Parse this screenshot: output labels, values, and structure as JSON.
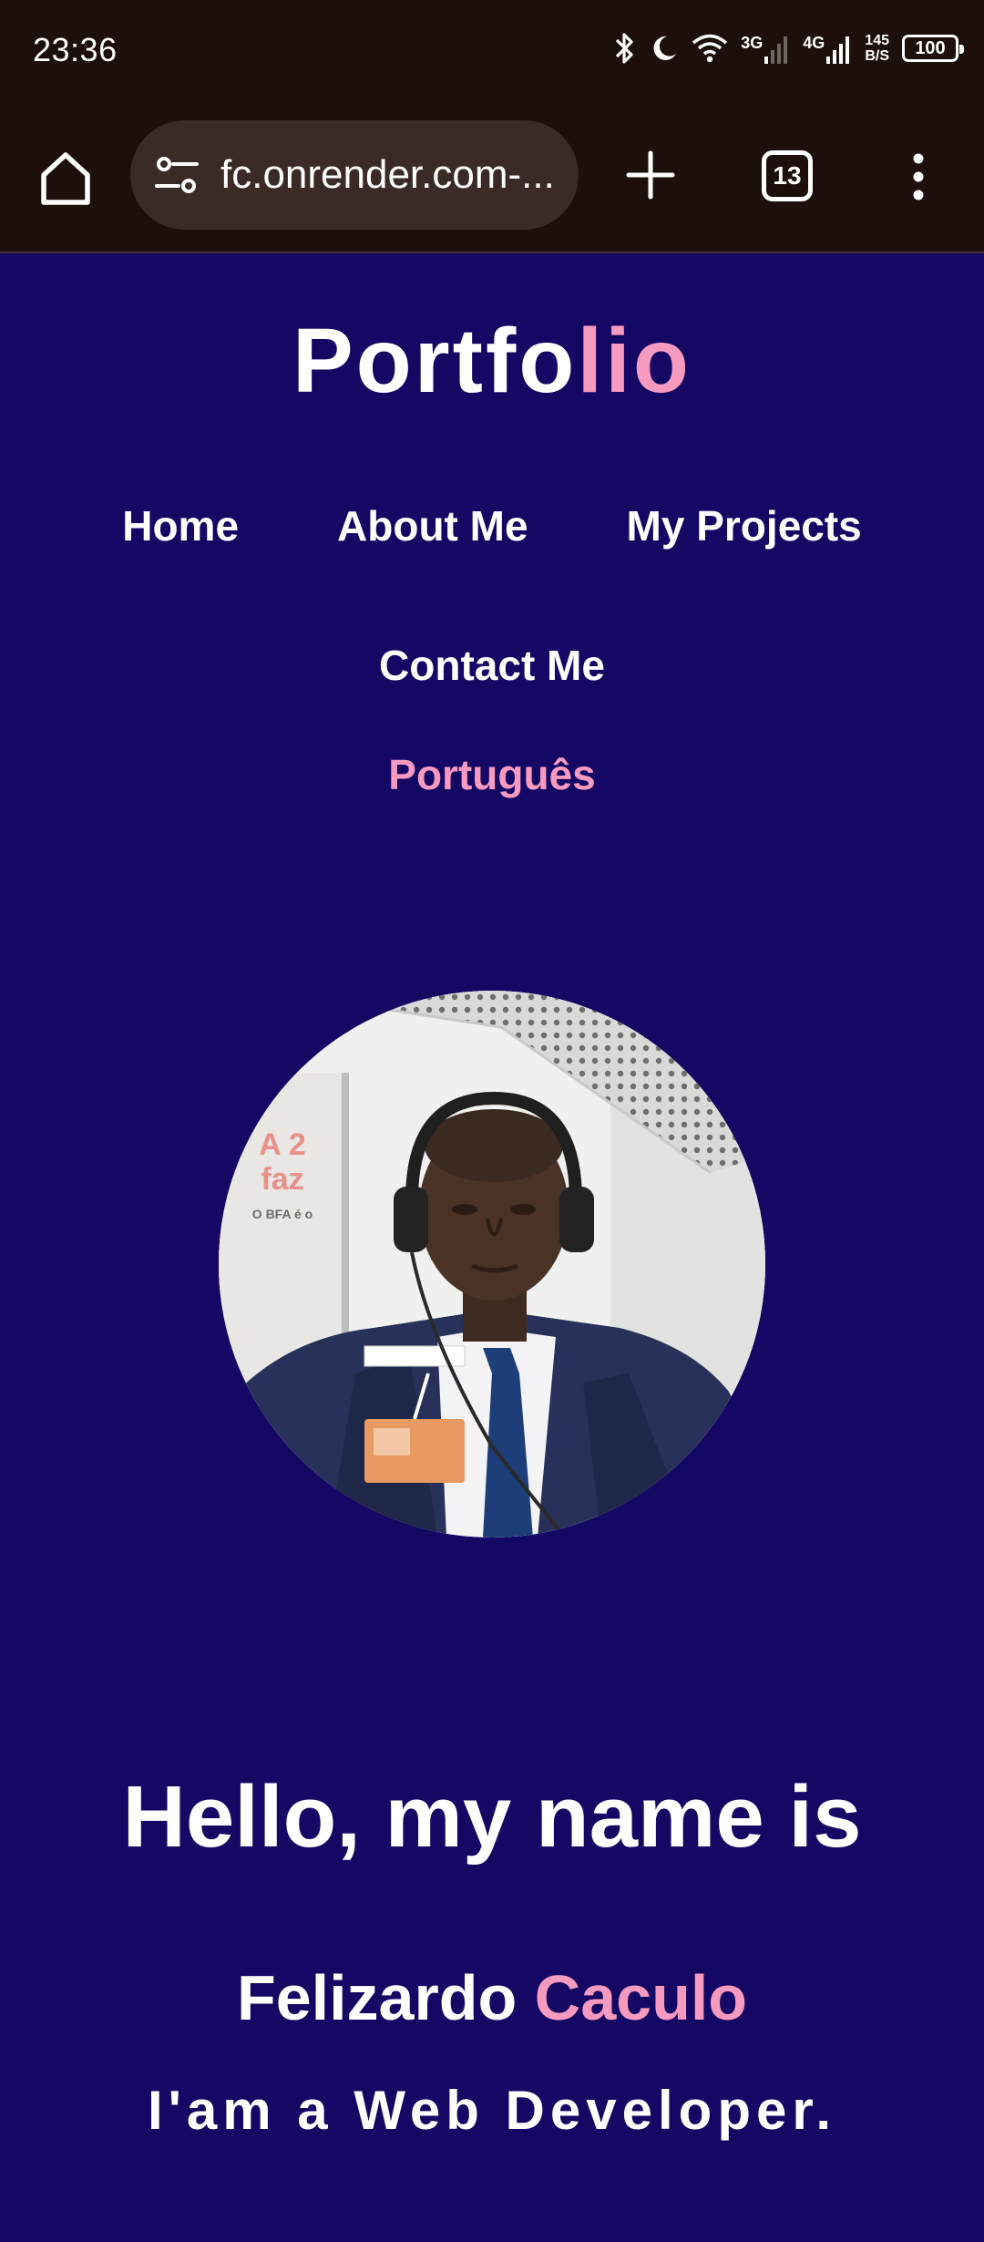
{
  "status_bar": {
    "time": "23:36",
    "network_1": "3G",
    "network_2": "4G",
    "speed_value": "145",
    "speed_unit": "B/S",
    "battery": "100",
    "icons": [
      "bluetooth-icon",
      "moon-icon",
      "wifi-icon",
      "signal-icon",
      "signal-icon"
    ]
  },
  "browser": {
    "url": "...-fc.onrender.com",
    "tab_count": "13",
    "icons": [
      "home-icon",
      "tune-icon",
      "plus-icon",
      "more-vert-icon"
    ]
  },
  "site": {
    "logo_main": "Portfo",
    "logo_accent": "lio",
    "nav": {
      "home": "Home",
      "about": "About Me",
      "projects": "My Projects",
      "contact": "Contact Me",
      "language": "Português"
    },
    "hero": {
      "greeting": "Hello, my name is",
      "first_name": "Felizardo",
      "last_name": "Caculo",
      "role": "I'am a Web Developer."
    }
  },
  "colors": {
    "background": "#150764",
    "accent": "#f79ac0",
    "browser_chrome": "#1d0f0b",
    "url_pill": "#3a2b26"
  }
}
